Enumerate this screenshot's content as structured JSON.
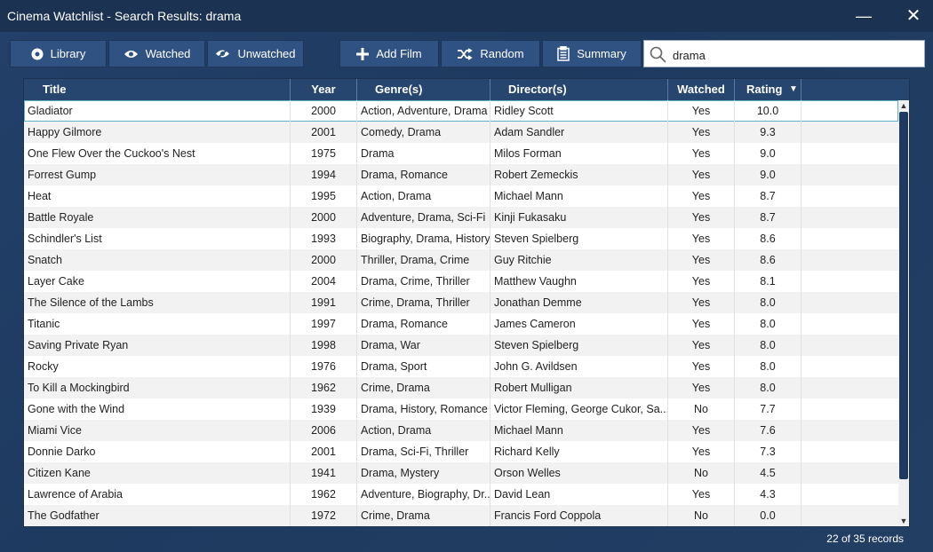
{
  "window": {
    "title": "Cinema Watchlist - Search Results: drama",
    "min_glyph": "—",
    "close_glyph": "✕"
  },
  "toolbar": {
    "library": "Library",
    "watched": "Watched",
    "unwatched": "Unwatched",
    "add_film": "Add Film",
    "random": "Random",
    "summary": "Summary"
  },
  "search": {
    "value": "drama",
    "icon": "search-icon"
  },
  "table": {
    "columns": [
      "Title",
      "Year",
      "Genre(s)",
      "Director(s)",
      "Watched",
      "Rating"
    ],
    "sort_column": "Rating",
    "sort_indicator": "▼",
    "rows": [
      [
        "Gladiator",
        "2000",
        "Action, Adventure, Drama",
        "Ridley Scott",
        "Yes",
        "10.0"
      ],
      [
        "Happy Gilmore",
        "2001",
        "Comedy, Drama",
        "Adam Sandler",
        "Yes",
        "9.3"
      ],
      [
        "One Flew Over the Cuckoo's Nest",
        "1975",
        "Drama",
        "Milos Forman",
        "Yes",
        "9.0"
      ],
      [
        "Forrest Gump",
        "1994",
        "Drama, Romance",
        "Robert Zemeckis",
        "Yes",
        "9.0"
      ],
      [
        "Heat",
        "1995",
        "Action, Drama",
        "Michael Mann",
        "Yes",
        "8.7"
      ],
      [
        "Battle Royale",
        "2000",
        "Adventure, Drama, Sci-Fi",
        "Kinji Fukasaku",
        "Yes",
        "8.7"
      ],
      [
        "Schindler's List",
        "1993",
        "Biography, Drama, History",
        "Steven Spielberg",
        "Yes",
        "8.6"
      ],
      [
        "Snatch",
        "2000",
        "Thriller, Drama, Crime",
        "Guy Ritchie",
        "Yes",
        "8.6"
      ],
      [
        "Layer Cake",
        "2004",
        "Drama, Crime, Thriller",
        "Matthew Vaughn",
        "Yes",
        "8.1"
      ],
      [
        "The Silence of the Lambs",
        "1991",
        "Crime, Drama, Thriller",
        "Jonathan Demme",
        "Yes",
        "8.0"
      ],
      [
        "Titanic",
        "1997",
        "Drama, Romance",
        "James Cameron",
        "Yes",
        "8.0"
      ],
      [
        "Saving Private Ryan",
        "1998",
        "Drama, War",
        "Steven Spielberg",
        "Yes",
        "8.0"
      ],
      [
        "Rocky",
        "1976",
        "Drama, Sport",
        "John G. Avildsen",
        "Yes",
        "8.0"
      ],
      [
        "To Kill a Mockingbird",
        "1962",
        "Crime, Drama",
        "Robert Mulligan",
        "Yes",
        "8.0"
      ],
      [
        "Gone with the Wind",
        "1939",
        "Drama, History, Romance",
        "Victor Fleming, George Cukor, Sa...",
        "No",
        "7.7"
      ],
      [
        "Miami Vice",
        "2006",
        "Action, Drama",
        "Michael Mann",
        "Yes",
        "7.6"
      ],
      [
        "Donnie Darko",
        "2001",
        "Drama, Sci-Fi, Thriller",
        "Richard Kelly",
        "Yes",
        "7.3"
      ],
      [
        "Citizen Kane",
        "1941",
        "Drama, Mystery",
        "Orson Welles",
        "No",
        "4.5"
      ],
      [
        "Lawrence of Arabia",
        "1962",
        "Adventure, Biography, Dr...",
        "David Lean",
        "Yes",
        "4.3"
      ],
      [
        "The Godfather",
        "1972",
        "Crime, Drama",
        "Francis Ford Coppola",
        "No",
        "0.0"
      ]
    ]
  },
  "status": {
    "records": "22 of 35 records"
  },
  "colors": {
    "background": "#1e3a5f",
    "titlebar": "#1b3253",
    "button": "#2f5283",
    "header": "#27466f",
    "selection_outline": "#5fb3c9"
  }
}
